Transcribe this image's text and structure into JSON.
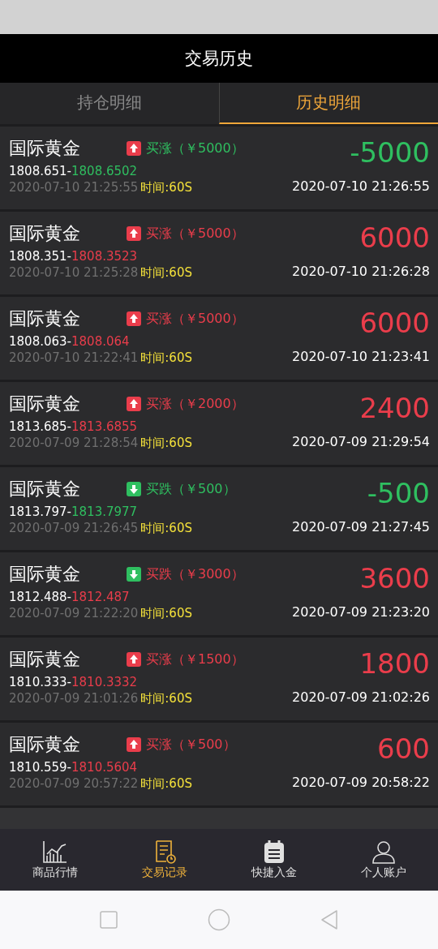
{
  "header": {
    "title": "交易历史"
  },
  "tabs": [
    {
      "label": "持仓明细",
      "selected": false
    },
    {
      "label": "历史明细",
      "selected": true
    }
  ],
  "records": [
    {
      "name": "国际黄金",
      "kind": "up",
      "trade": "买涨（￥5000）",
      "color": "#2fbf60",
      "open": "1808.651-",
      "close": "1808.6502",
      "open_time": "2020-07-10 21:25:55",
      "duration": "时间:60S",
      "amount": "-5000",
      "close_time": "2020-07-10 21:26:55"
    },
    {
      "name": "国际黄金",
      "kind": "up",
      "trade": "买涨（￥5000）",
      "color": "#ea3d4b",
      "open": "1808.351-",
      "close": "1808.3523",
      "open_time": "2020-07-10 21:25:28",
      "duration": "时间:60S",
      "amount": "6000",
      "close_time": "2020-07-10 21:26:28"
    },
    {
      "name": "国际黄金",
      "kind": "up",
      "trade": "买涨（￥5000）",
      "color": "#ea3d4b",
      "open": "1808.063-",
      "close": "1808.064",
      "open_time": "2020-07-10 21:22:41",
      "duration": "时间:60S",
      "amount": "6000",
      "close_time": "2020-07-10 21:23:41"
    },
    {
      "name": "国际黄金",
      "kind": "up",
      "trade": "买涨（￥2000）",
      "color": "#ea3d4b",
      "open": "1813.685-",
      "close": "1813.6855",
      "open_time": "2020-07-09 21:28:54",
      "duration": "时间:60S",
      "amount": "2400",
      "close_time": "2020-07-09 21:29:54"
    },
    {
      "name": "国际黄金",
      "kind": "down",
      "trade": "买跌（￥500）",
      "color": "#2fbf60",
      "open": "1813.797-",
      "close": "1813.7977",
      "open_time": "2020-07-09 21:26:45",
      "duration": "时间:60S",
      "amount": "-500",
      "close_time": "2020-07-09 21:27:45"
    },
    {
      "name": "国际黄金",
      "kind": "down",
      "trade": "买跌（￥3000）",
      "color": "#ea3d4b",
      "open": "1812.488-",
      "close": "1812.487",
      "open_time": "2020-07-09 21:22:20",
      "duration": "时间:60S",
      "amount": "3600",
      "close_time": "2020-07-09 21:23:20"
    },
    {
      "name": "国际黄金",
      "kind": "up",
      "trade": "买涨（￥1500）",
      "color": "#ea3d4b",
      "open": "1810.333-",
      "close": "1810.3332",
      "open_time": "2020-07-09 21:01:26",
      "duration": "时间:60S",
      "amount": "1800",
      "close_time": "2020-07-09 21:02:26"
    },
    {
      "name": "国际黄金",
      "kind": "up",
      "trade": "买涨（￥500）",
      "color": "#ea3d4b",
      "open": "1810.559-",
      "close": "1810.5604",
      "open_time": "2020-07-09 20:57:22",
      "duration": "时间:60S",
      "amount": "600",
      "close_time": "2020-07-09 20:58:22"
    }
  ],
  "bottom_nav": [
    {
      "label": "商品行情",
      "kind": "chart",
      "selected": false
    },
    {
      "label": "交易记录",
      "kind": "records",
      "selected": true
    },
    {
      "label": "快捷入金",
      "kind": "deposit",
      "selected": false
    },
    {
      "label": "个人账户",
      "kind": "account",
      "selected": false
    }
  ]
}
